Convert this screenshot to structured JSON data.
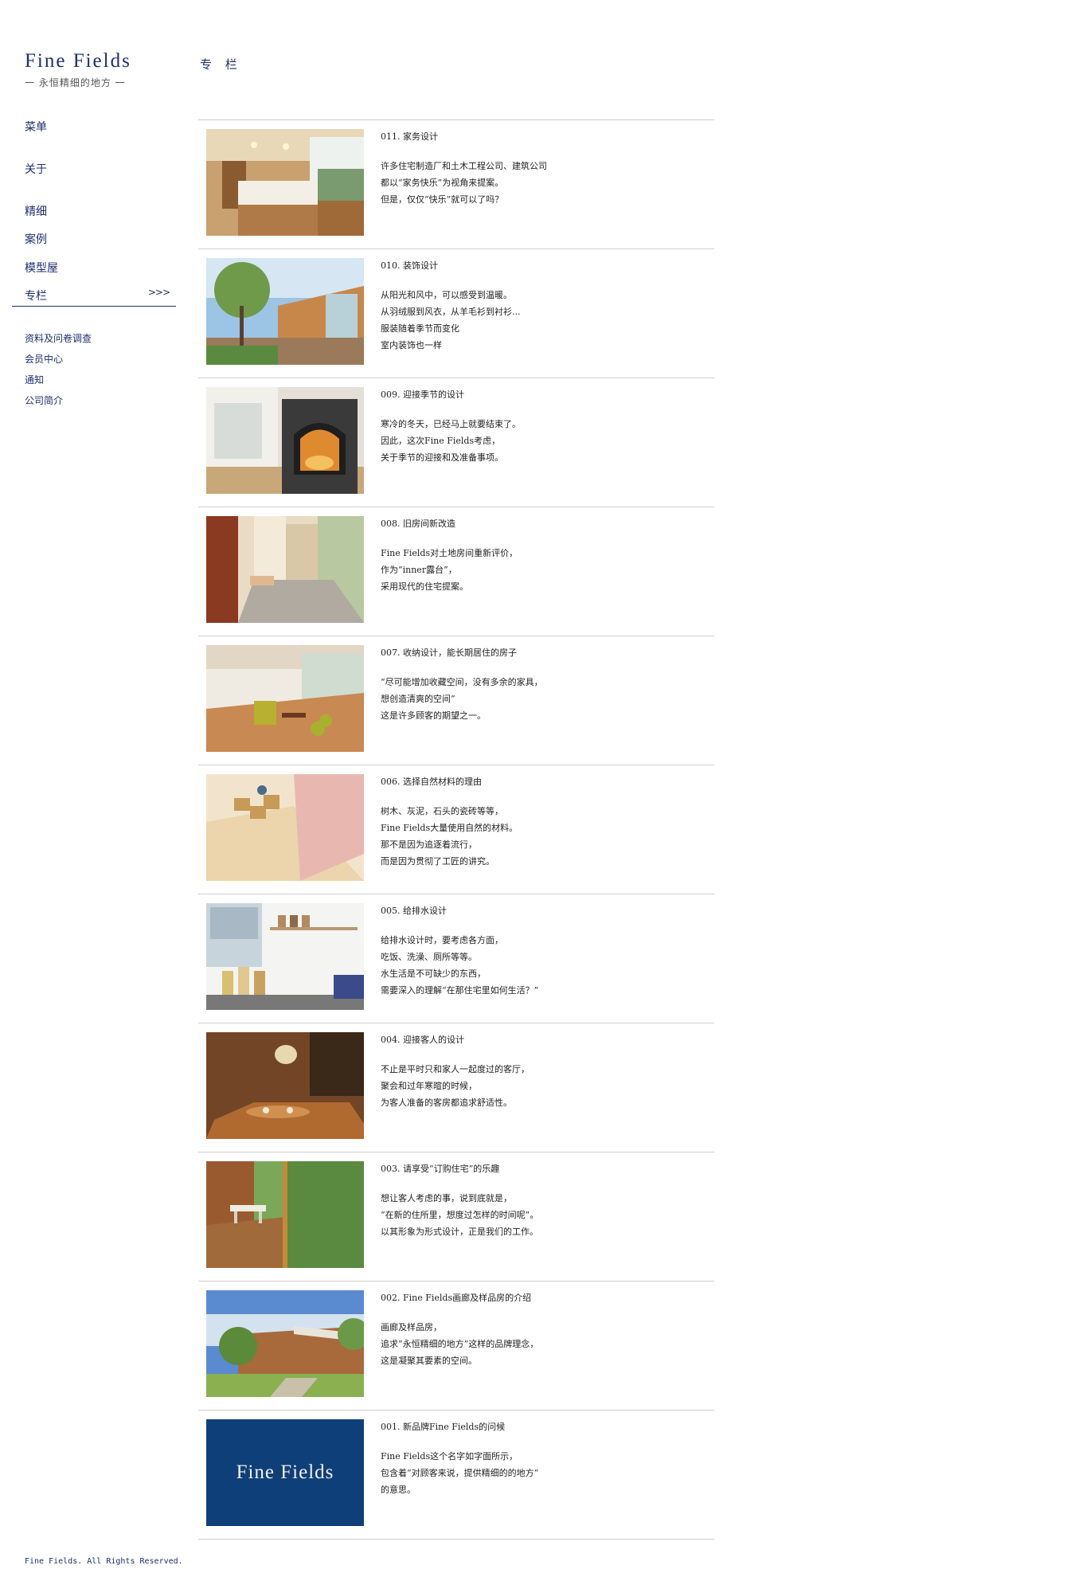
{
  "brand": {
    "title": "Fine Fields",
    "subtitle": "一 永恒精细的地方 一"
  },
  "nav": {
    "main": [
      {
        "label": "菜单"
      },
      {
        "label": "关于"
      },
      {
        "label": "精细"
      },
      {
        "label": "案例"
      },
      {
        "label": "模型屋"
      },
      {
        "label": "专栏",
        "arrow": ">>>"
      }
    ],
    "secondary": [
      {
        "label": "资料及问卷调查"
      },
      {
        "label": "会员中心"
      },
      {
        "label": "通知"
      },
      {
        "label": "公司简介"
      }
    ]
  },
  "page_title": "专 栏",
  "articles": [
    {
      "title": "011. 家务设计",
      "lines": [
        "许多住宅制造厂和土木工程公司、建筑公司",
        "都以“家务快乐”为视角来提案。",
        "但是，仅仅“快乐”就可以了吗？"
      ]
    },
    {
      "title": "010. 装饰设计",
      "lines": [
        "从阳光和风中，可以感受到温暖。",
        "从羽绒服到风衣，从羊毛衫到衬衫...",
        "服装随着季节而变化",
        "室内装饰也一样"
      ]
    },
    {
      "title": "009. 迎接季节的设计",
      "lines": [
        "寒冷的冬天，已经马上就要结束了。",
        "因此，这次Fine Fields考虑，",
        "关于季节的迎接和及准备事项。"
      ]
    },
    {
      "title": "008. 旧房间新改造",
      "lines": [
        "Fine Fields对土地房间重新评价，",
        "作为“inner露台”，",
        "采用现代的住宅提案。"
      ]
    },
    {
      "title": "007. 收纳设计，能长期居住的房子",
      "lines": [
        "“尽可能增加收藏空间，没有多余的家具，",
        "想创造清爽的空间”",
        "这是许多顾客的期望之一。"
      ]
    },
    {
      "title": "006. 选择自然材料的理由",
      "lines": [
        "树木、灰泥，石头的瓷砖等等，",
        "Fine Fields大量使用自然的材料。",
        "那不是因为追逐着流行，",
        "而是因为贯彻了工匠的讲究。"
      ]
    },
    {
      "title": "005. 给排水设计",
      "lines": [
        "给排水设计时，要考虑各方面，",
        "吃饭、洗澡、厕所等等。",
        "水生活是不可缺少的东西，",
        "需要深入的理解“在那住宅里如何生活？”"
      ]
    },
    {
      "title": "004. 迎接客人的设计",
      "lines": [
        "不止是平时只和家人一起度过的客厅，",
        "聚会和过年寒暄的时候，",
        "为客人准备的客房都追求舒适性。"
      ]
    },
    {
      "title": "003. 请享受“订购住宅”的乐趣",
      "lines": [
        "想让客人考虑的事，说到底就是，",
        "“在新的住所里，想度过怎样的时间呢”。",
        "以其形象为形式设计，正是我们的工作。"
      ]
    },
    {
      "title": "002. Fine Fields画廊及样品房的介绍",
      "lines": [
        "画廊及样品房，",
        "追求“永恒精细的地方”这样的品牌理念，",
        "这是凝聚其要素的空间。"
      ]
    },
    {
      "title": "001. 新品牌Fine Fields的问候",
      "lines": [
        "Fine Fields这个名字如字面所示，",
        "包含着“对顾客来说，提供精细的的地方”",
        "的意思。"
      ],
      "thumb_text": "Fine Fields"
    }
  ],
  "footer": {
    "copyright": "Fine Fields. All Rights Reserved."
  }
}
